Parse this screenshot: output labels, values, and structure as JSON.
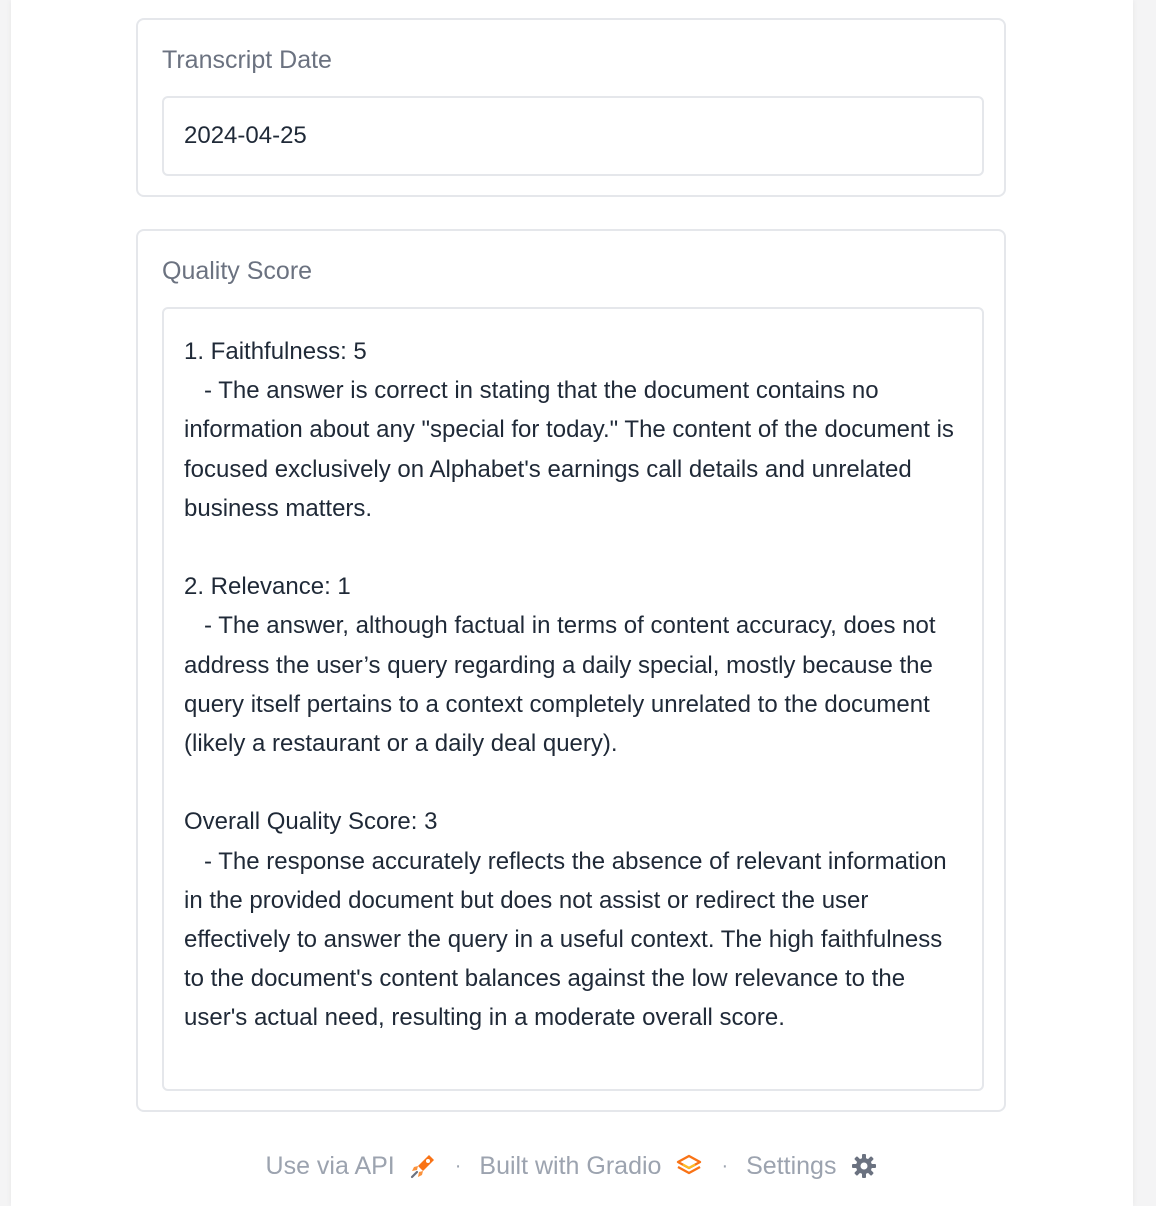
{
  "transcript_date": {
    "label": "Transcript Date",
    "value": "2024-04-25"
  },
  "quality_score": {
    "label": "Quality Score",
    "value": "1. Faithfulness: 5\n   - The answer is correct in stating that the document contains no information about any \"special for today.\" The content of the document is focused exclusively on Alphabet's earnings call details and unrelated business matters.\n\n2. Relevance: 1\n   - The answer, although factual in terms of content accuracy, does not address the user’s query regarding a daily special, mostly because the query itself pertains to a context completely unrelated to the document (likely a restaurant or a daily deal query).\n\nOverall Quality Score: 3\n   - The response accurately reflects the absence of relevant information in the provided document but does not assist or redirect the user effectively to answer the query in a useful context. The high faithfulness to the document's content balances against the low relevance to the user's actual need, resulting in a moderate overall score."
  },
  "footer": {
    "api_label": "Use via API",
    "api_icon": "rocket-icon",
    "separator": "·",
    "built_label": "Built with Gradio",
    "built_icon": "gradio-logo-icon",
    "settings_label": "Settings",
    "settings_icon": "gear-icon"
  },
  "colors": {
    "label": "#6b7280",
    "border": "#e5e7eb",
    "text": "#1f2937",
    "footer_text": "#9ca3af",
    "accent": "#f97316"
  }
}
